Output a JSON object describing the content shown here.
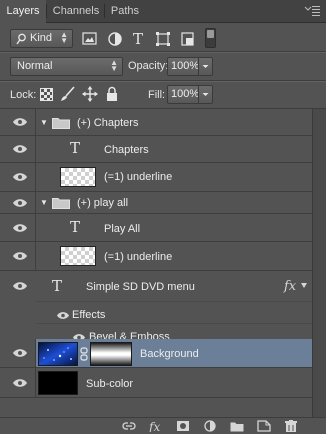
{
  "tabs": [
    {
      "label": "Layers"
    },
    {
      "label": "Channels"
    },
    {
      "label": "Paths"
    }
  ],
  "filter": {
    "kind_label": "Kind"
  },
  "blend": {
    "mode": "Normal",
    "opacity_label": "Opacity:",
    "opacity_value": "100%"
  },
  "lock": {
    "label": "Lock:",
    "fill_label": "Fill:",
    "fill_value": "100%"
  },
  "layers": [
    {
      "name": "(+) Chapters"
    },
    {
      "name": "Chapters"
    },
    {
      "name": "(=1) underline"
    },
    {
      "name": "(+) play all"
    },
    {
      "name": "Play All"
    },
    {
      "name": "(=1) underline"
    },
    {
      "name": "Simple SD DVD menu"
    },
    {
      "name": "Effects"
    },
    {
      "name": "Bevel & Emboss"
    },
    {
      "name": "Background"
    },
    {
      "name": "Sub-color"
    }
  ],
  "colors": {
    "selected_row": "#6b7f99",
    "panel_bg": "#535353"
  },
  "icons": [
    "eye-icon",
    "folder-icon",
    "type-layer-icon",
    "fx-icon",
    "link-icon",
    "new-group-icon",
    "new-layer-icon",
    "trash-icon"
  ]
}
